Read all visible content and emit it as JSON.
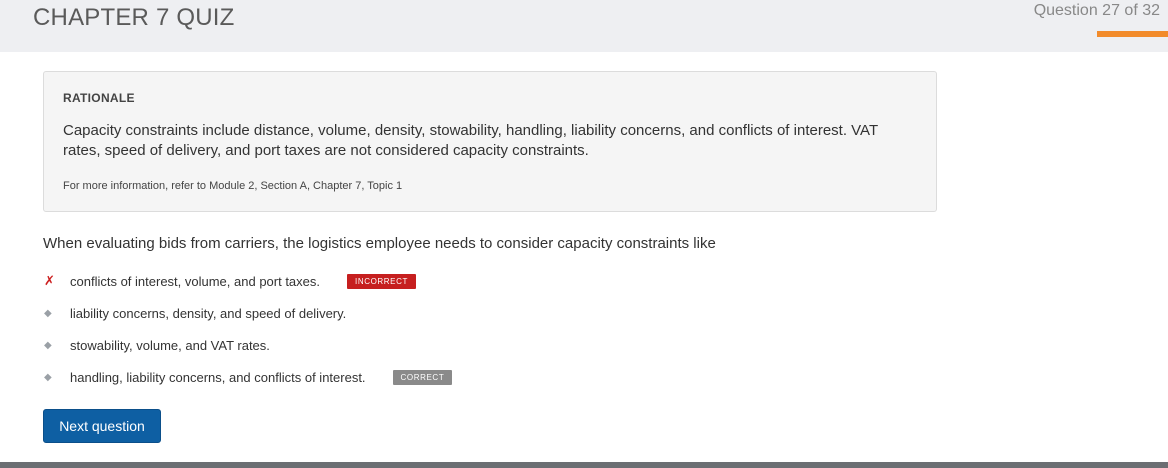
{
  "header": {
    "title": "CHAPTER 7 QUIZ",
    "progress_text": "Question 27 of 32",
    "progress": {
      "current": 27,
      "total": 32
    },
    "accent_color": "#f28b2b"
  },
  "rationale": {
    "heading": "RATIONALE",
    "text": "Capacity constraints include distance, volume, density, stowability, handling, liability concerns, and conflicts of interest. VAT rates, speed of delivery, and port taxes are not considered capacity constraints.",
    "reference": "For more information, refer to Module 2, Section A, Chapter 7, Topic 1"
  },
  "question": {
    "text": "When evaluating bids from carriers, the logistics employee needs to consider capacity constraints like",
    "answers": [
      {
        "label": "conflicts of interest, volume, and port taxes.",
        "marker": "✗",
        "badge": "INCORRECT",
        "status": "incorrect"
      },
      {
        "label": "liability concerns, density, and speed of delivery.",
        "marker": "◆",
        "badge": "",
        "status": ""
      },
      {
        "label": "stowability, volume, and VAT rates.",
        "marker": "◆",
        "badge": "",
        "status": ""
      },
      {
        "label": "handling, liability concerns, and conflicts of interest.",
        "marker": "◆",
        "badge": "CORRECT",
        "status": "correct"
      }
    ]
  },
  "actions": {
    "next_label": "Next question",
    "button_color": "#0e5fa3"
  },
  "colors": {
    "incorrect": "#c61f1f",
    "correct": "#8a8a8a"
  }
}
